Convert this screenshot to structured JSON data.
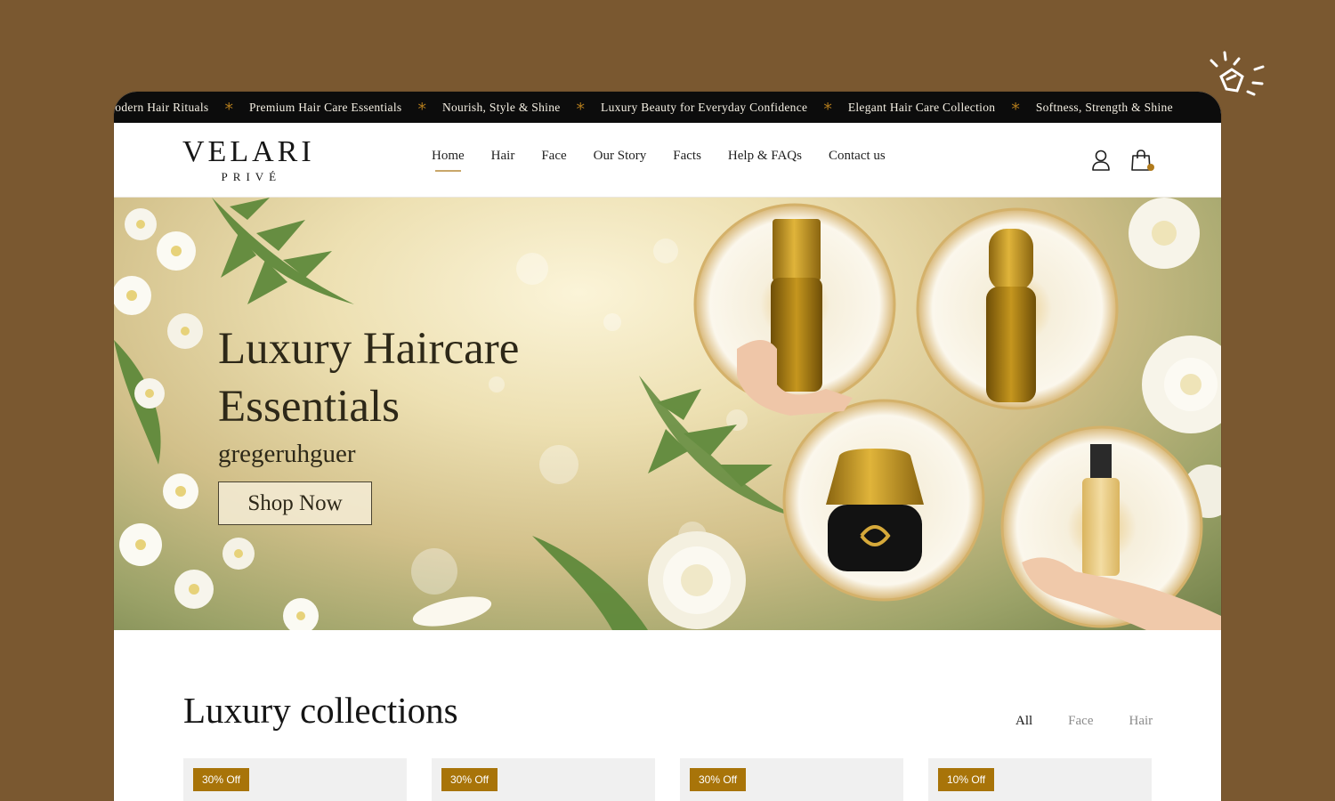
{
  "marquee": {
    "items": [
      "Modern Hair Rituals",
      "Premium Hair Care Essentials",
      "Nourish, Style & Shine",
      "Luxury Beauty for Everyday Confidence",
      "Elegant Hair Care Collection",
      "Softness, Strength & Shine"
    ],
    "separator": "*"
  },
  "brand": {
    "name": "VELARI",
    "sub": "PRIVÉ"
  },
  "nav": {
    "items": [
      "Home",
      "Hair",
      "Face",
      "Our Story",
      "Facts",
      "Help & FAQs",
      "Contact us"
    ],
    "active": "Home"
  },
  "header_icons": [
    "user-icon",
    "shopping-bag-icon"
  ],
  "hero": {
    "title_line1": "Luxury Haircare",
    "title_line2": "Essentials",
    "subtitle": "gregeruhguer",
    "cta": "Shop Now"
  },
  "collections": {
    "title": "Luxury collections",
    "filters": [
      "All",
      "Face",
      "Hair"
    ],
    "active_filter": "All",
    "cards": [
      {
        "badge": "30% Off"
      },
      {
        "badge": "30% Off"
      },
      {
        "badge": "30% Off"
      },
      {
        "badge": "10% Off"
      }
    ]
  },
  "colors": {
    "background": "#7a5830",
    "accent": "#a87409",
    "marquee_bg": "#0c0c0c",
    "text_dark": "#151515"
  }
}
